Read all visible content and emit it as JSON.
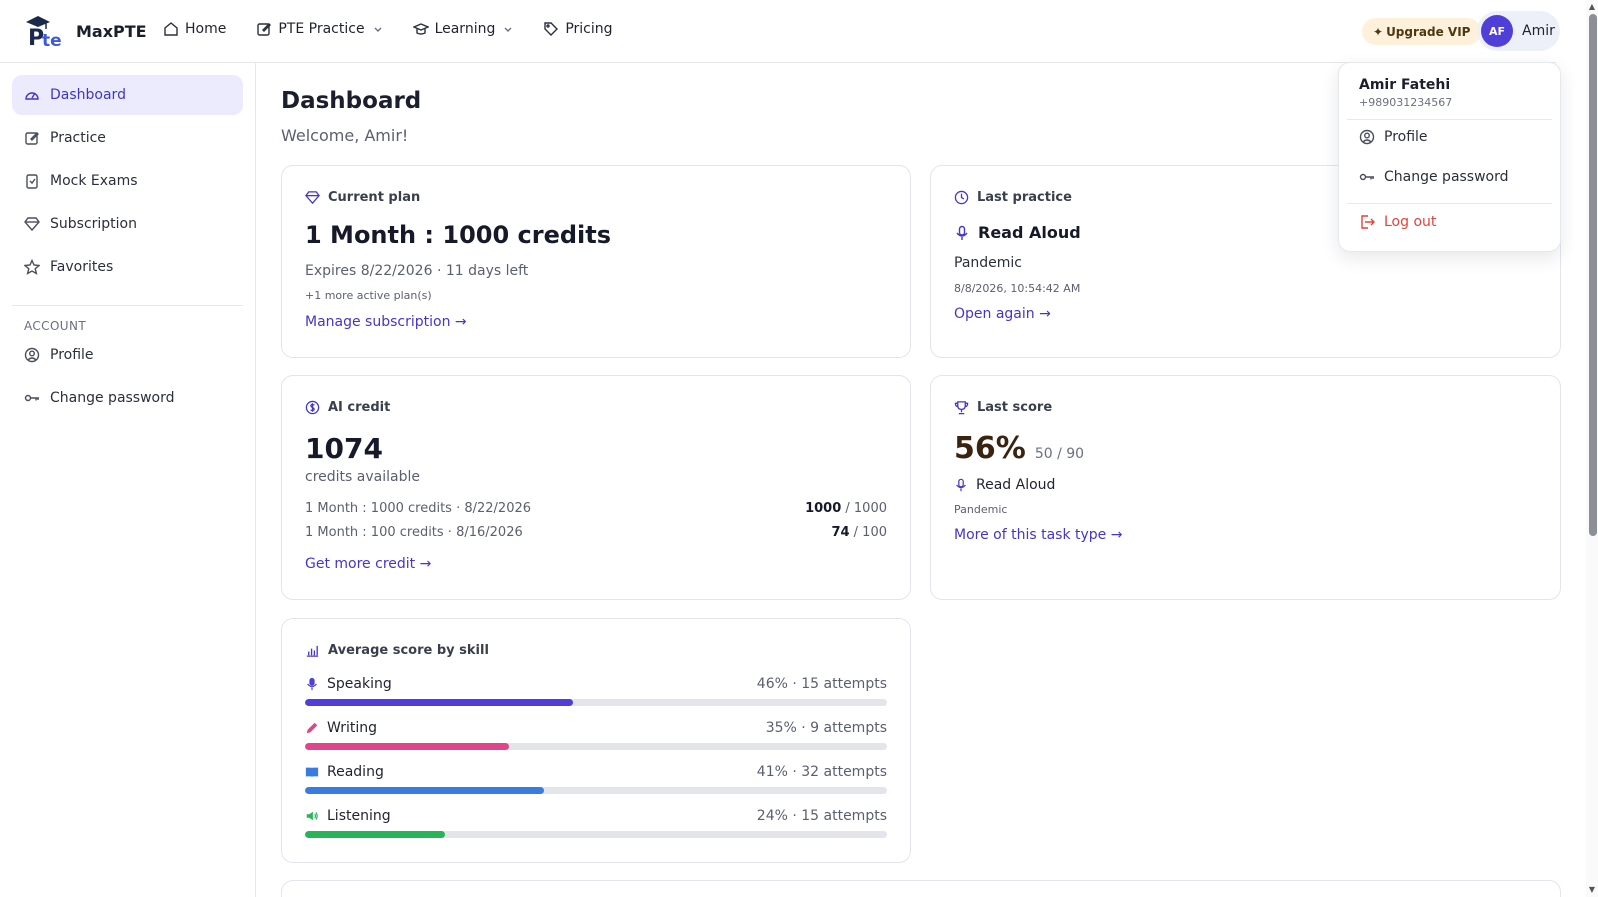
{
  "brand": {
    "name": "MaxPTE",
    "logo_text": "Pte"
  },
  "nav": {
    "home": "Home",
    "pte_practice": "PTE Practice",
    "learning": "Learning",
    "pricing": "Pricing"
  },
  "header": {
    "upgrade_label": "Upgrade VIP",
    "avatar_initials": "AF",
    "user_short": "Amir"
  },
  "sidebar": {
    "items": [
      {
        "label": "Dashboard",
        "icon": "gauge-icon",
        "active": true
      },
      {
        "label": "Practice",
        "icon": "edit-icon"
      },
      {
        "label": "Mock Exams",
        "icon": "clipboard-icon"
      },
      {
        "label": "Subscription",
        "icon": "diamond-icon"
      },
      {
        "label": "Favorites",
        "icon": "star-icon"
      }
    ],
    "account_heading": "ACCOUNT",
    "account_items": [
      {
        "label": "Profile",
        "icon": "user-circle-icon"
      },
      {
        "label": "Change password",
        "icon": "key-icon"
      }
    ]
  },
  "page": {
    "title": "Dashboard",
    "welcome": "Welcome, Amir!"
  },
  "current_plan": {
    "heading": "Current plan",
    "plan": "1 Month : 1000 credits",
    "expires": "Expires 8/22/2026 · 11 days left",
    "more_plans": "+1 more active plan(s)",
    "link": "Manage subscription →"
  },
  "last_practice": {
    "heading": "Last practice",
    "task": "Read Aloud",
    "topic": "Pandemic",
    "datetime": "8/8/2026, 10:54:42 AM",
    "link": "Open again →"
  },
  "ai_credit": {
    "heading": "AI credit",
    "amount": "1074",
    "caption": "credits available",
    "rows": [
      {
        "label": "1 Month : 1000 credits · 8/22/2026",
        "used": "1000",
        "total": " / 1000"
      },
      {
        "label": "1 Month : 100 credits · 8/16/2026",
        "used": "74",
        "total": " / 100"
      }
    ],
    "link": "Get more credit →"
  },
  "last_score": {
    "heading": "Last score",
    "percent": "56%",
    "raw": "50 / 90",
    "task": "Read Aloud",
    "topic": "Pandemic",
    "link": "More of this task type →"
  },
  "avg_score": {
    "heading": "Average score by skill",
    "skills": [
      {
        "name": "Speaking",
        "stat": "46% · 15 attempts",
        "value": 0.46,
        "color": "#4f3fd8"
      },
      {
        "name": "Writing",
        "stat": "35% · 9 attempts",
        "value": 0.35,
        "color": "#e0448a"
      },
      {
        "name": "Reading",
        "stat": "41% · 32 attempts",
        "value": 0.41,
        "color": "#3b7be0"
      },
      {
        "name": "Listening",
        "stat": "24% · 15 attempts",
        "value": 0.24,
        "color": "#27b35a"
      }
    ]
  },
  "dropdown": {
    "name": "Amir Fatehi",
    "phone": "+989031234567",
    "profile": "Profile",
    "change_password": "Change password",
    "logout": "Log out"
  },
  "colors": {
    "accent": "#4535c9",
    "active_bg": "#ecebfd",
    "vip_bg": "#fdf1dc",
    "danger": "#e0443a"
  }
}
